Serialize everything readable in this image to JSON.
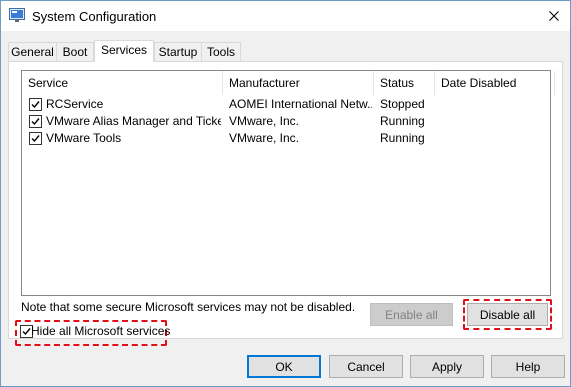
{
  "window": {
    "title": "System Configuration"
  },
  "tabs": [
    {
      "label": "General"
    },
    {
      "label": "Boot"
    },
    {
      "label": "Services",
      "active": true
    },
    {
      "label": "Startup"
    },
    {
      "label": "Tools"
    }
  ],
  "services_table": {
    "columns": [
      "Service",
      "Manufacturer",
      "Status",
      "Date Disabled"
    ],
    "rows": [
      {
        "checked": true,
        "service": "RCService",
        "manufacturer": "AOMEI International Netw...",
        "status": "Stopped",
        "date_disabled": ""
      },
      {
        "checked": true,
        "service": "VMware Alias Manager and Ticke...",
        "manufacturer": "VMware, Inc.",
        "status": "Running",
        "date_disabled": ""
      },
      {
        "checked": true,
        "service": "VMware Tools",
        "manufacturer": "VMware, Inc.",
        "status": "Running",
        "date_disabled": ""
      }
    ]
  },
  "note": "Note that some secure Microsoft services may not be disabled.",
  "buttons": {
    "enable_all": "Enable all",
    "disable_all": "Disable all",
    "ok": "OK",
    "cancel": "Cancel",
    "apply": "Apply",
    "help": "Help"
  },
  "hide_microsoft": {
    "label": "Hide all Microsoft services",
    "checked": true
  },
  "colors": {
    "highlight_dash": "#e0101a",
    "default_button_border": "#0078d7"
  },
  "icons": {
    "app": "msconfig-icon",
    "close": "close-icon",
    "check": "checkmark-icon"
  }
}
